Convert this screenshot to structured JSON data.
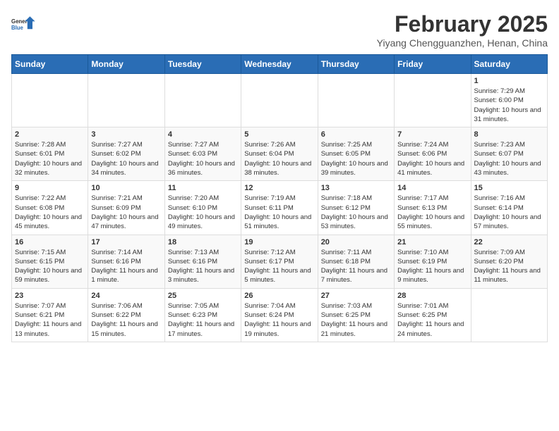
{
  "header": {
    "logo_line1": "General",
    "logo_line2": "Blue",
    "month_title": "February 2025",
    "location": "Yiyang Chengguanzhen, Henan, China"
  },
  "weekdays": [
    "Sunday",
    "Monday",
    "Tuesday",
    "Wednesday",
    "Thursday",
    "Friday",
    "Saturday"
  ],
  "weeks": [
    [
      {
        "day": "",
        "info": ""
      },
      {
        "day": "",
        "info": ""
      },
      {
        "day": "",
        "info": ""
      },
      {
        "day": "",
        "info": ""
      },
      {
        "day": "",
        "info": ""
      },
      {
        "day": "",
        "info": ""
      },
      {
        "day": "1",
        "info": "Sunrise: 7:29 AM\nSunset: 6:00 PM\nDaylight: 10 hours and 31 minutes."
      }
    ],
    [
      {
        "day": "2",
        "info": "Sunrise: 7:28 AM\nSunset: 6:01 PM\nDaylight: 10 hours and 32 minutes."
      },
      {
        "day": "3",
        "info": "Sunrise: 7:27 AM\nSunset: 6:02 PM\nDaylight: 10 hours and 34 minutes."
      },
      {
        "day": "4",
        "info": "Sunrise: 7:27 AM\nSunset: 6:03 PM\nDaylight: 10 hours and 36 minutes."
      },
      {
        "day": "5",
        "info": "Sunrise: 7:26 AM\nSunset: 6:04 PM\nDaylight: 10 hours and 38 minutes."
      },
      {
        "day": "6",
        "info": "Sunrise: 7:25 AM\nSunset: 6:05 PM\nDaylight: 10 hours and 39 minutes."
      },
      {
        "day": "7",
        "info": "Sunrise: 7:24 AM\nSunset: 6:06 PM\nDaylight: 10 hours and 41 minutes."
      },
      {
        "day": "8",
        "info": "Sunrise: 7:23 AM\nSunset: 6:07 PM\nDaylight: 10 hours and 43 minutes."
      }
    ],
    [
      {
        "day": "9",
        "info": "Sunrise: 7:22 AM\nSunset: 6:08 PM\nDaylight: 10 hours and 45 minutes."
      },
      {
        "day": "10",
        "info": "Sunrise: 7:21 AM\nSunset: 6:09 PM\nDaylight: 10 hours and 47 minutes."
      },
      {
        "day": "11",
        "info": "Sunrise: 7:20 AM\nSunset: 6:10 PM\nDaylight: 10 hours and 49 minutes."
      },
      {
        "day": "12",
        "info": "Sunrise: 7:19 AM\nSunset: 6:11 PM\nDaylight: 10 hours and 51 minutes."
      },
      {
        "day": "13",
        "info": "Sunrise: 7:18 AM\nSunset: 6:12 PM\nDaylight: 10 hours and 53 minutes."
      },
      {
        "day": "14",
        "info": "Sunrise: 7:17 AM\nSunset: 6:13 PM\nDaylight: 10 hours and 55 minutes."
      },
      {
        "day": "15",
        "info": "Sunrise: 7:16 AM\nSunset: 6:14 PM\nDaylight: 10 hours and 57 minutes."
      }
    ],
    [
      {
        "day": "16",
        "info": "Sunrise: 7:15 AM\nSunset: 6:15 PM\nDaylight: 10 hours and 59 minutes."
      },
      {
        "day": "17",
        "info": "Sunrise: 7:14 AM\nSunset: 6:16 PM\nDaylight: 11 hours and 1 minute."
      },
      {
        "day": "18",
        "info": "Sunrise: 7:13 AM\nSunset: 6:16 PM\nDaylight: 11 hours and 3 minutes."
      },
      {
        "day": "19",
        "info": "Sunrise: 7:12 AM\nSunset: 6:17 PM\nDaylight: 11 hours and 5 minutes."
      },
      {
        "day": "20",
        "info": "Sunrise: 7:11 AM\nSunset: 6:18 PM\nDaylight: 11 hours and 7 minutes."
      },
      {
        "day": "21",
        "info": "Sunrise: 7:10 AM\nSunset: 6:19 PM\nDaylight: 11 hours and 9 minutes."
      },
      {
        "day": "22",
        "info": "Sunrise: 7:09 AM\nSunset: 6:20 PM\nDaylight: 11 hours and 11 minutes."
      }
    ],
    [
      {
        "day": "23",
        "info": "Sunrise: 7:07 AM\nSunset: 6:21 PM\nDaylight: 11 hours and 13 minutes."
      },
      {
        "day": "24",
        "info": "Sunrise: 7:06 AM\nSunset: 6:22 PM\nDaylight: 11 hours and 15 minutes."
      },
      {
        "day": "25",
        "info": "Sunrise: 7:05 AM\nSunset: 6:23 PM\nDaylight: 11 hours and 17 minutes."
      },
      {
        "day": "26",
        "info": "Sunrise: 7:04 AM\nSunset: 6:24 PM\nDaylight: 11 hours and 19 minutes."
      },
      {
        "day": "27",
        "info": "Sunrise: 7:03 AM\nSunset: 6:25 PM\nDaylight: 11 hours and 21 minutes."
      },
      {
        "day": "28",
        "info": "Sunrise: 7:01 AM\nSunset: 6:25 PM\nDaylight: 11 hours and 24 minutes."
      },
      {
        "day": "",
        "info": ""
      }
    ]
  ]
}
